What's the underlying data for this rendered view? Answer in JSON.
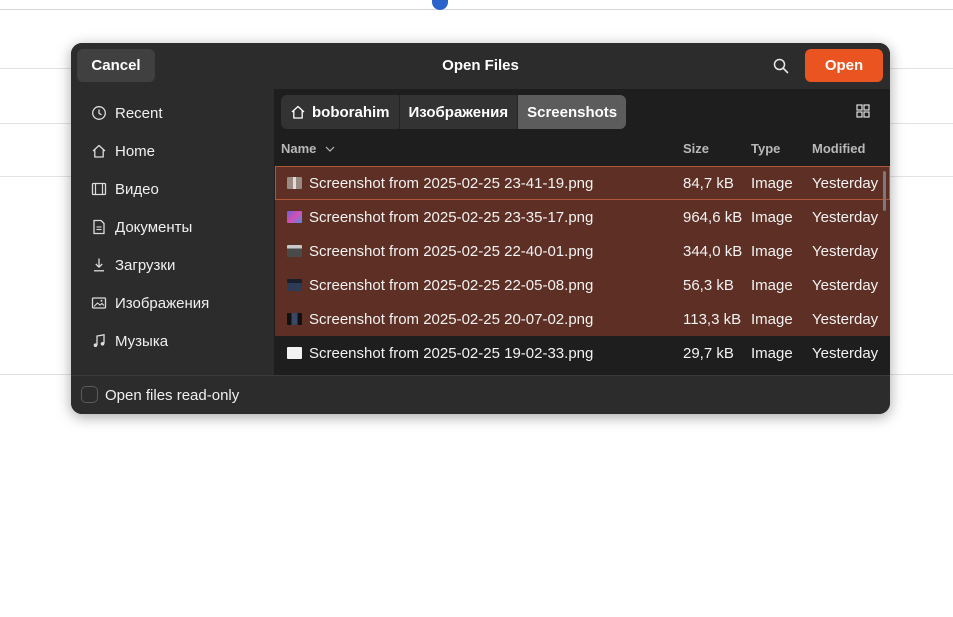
{
  "dialog": {
    "title": "Open Files",
    "cancel_label": "Cancel",
    "open_label": "Open",
    "accent_color": "#e95420"
  },
  "sidebar": {
    "items": [
      {
        "label": "Recent",
        "icon": "clock-icon"
      },
      {
        "label": "Home",
        "icon": "home-icon"
      },
      {
        "label": "Видео",
        "icon": "film-icon"
      },
      {
        "label": "Документы",
        "icon": "document-icon"
      },
      {
        "label": "Загрузки",
        "icon": "download-icon"
      },
      {
        "label": "Изображения",
        "icon": "image-icon"
      },
      {
        "label": "Музыка",
        "icon": "music-icon"
      }
    ]
  },
  "pathbar": {
    "crumbs": [
      "boborahim",
      "Изображения",
      "Screenshots"
    ]
  },
  "columns": {
    "name": "Name",
    "size": "Size",
    "type": "Type",
    "modified": "Modified"
  },
  "files": [
    {
      "name": "Screenshot from 2025-02-25 23-41-19.png",
      "size": "84,7 kB",
      "type": "Image",
      "modified": "Yesterday",
      "selected": true
    },
    {
      "name": "Screenshot from 2025-02-25 23-35-17.png",
      "size": "964,6 kB",
      "type": "Image",
      "modified": "Yesterday",
      "selected": true
    },
    {
      "name": "Screenshot from 2025-02-25 22-40-01.png",
      "size": "344,0 kB",
      "type": "Image",
      "modified": "Yesterday",
      "selected": true
    },
    {
      "name": "Screenshot from 2025-02-25 22-05-08.png",
      "size": "56,3 kB",
      "type": "Image",
      "modified": "Yesterday",
      "selected": true
    },
    {
      "name": "Screenshot from 2025-02-25 20-07-02.png",
      "size": "113,3 kB",
      "type": "Image",
      "modified": "Yesterday",
      "selected": true
    },
    {
      "name": "Screenshot from 2025-02-25 19-02-33.png",
      "size": "29,7 kB",
      "type": "Image",
      "modified": "Yesterday",
      "selected": false
    }
  ],
  "footer": {
    "readonly_label": "Open files read-only",
    "readonly_checked": false
  }
}
